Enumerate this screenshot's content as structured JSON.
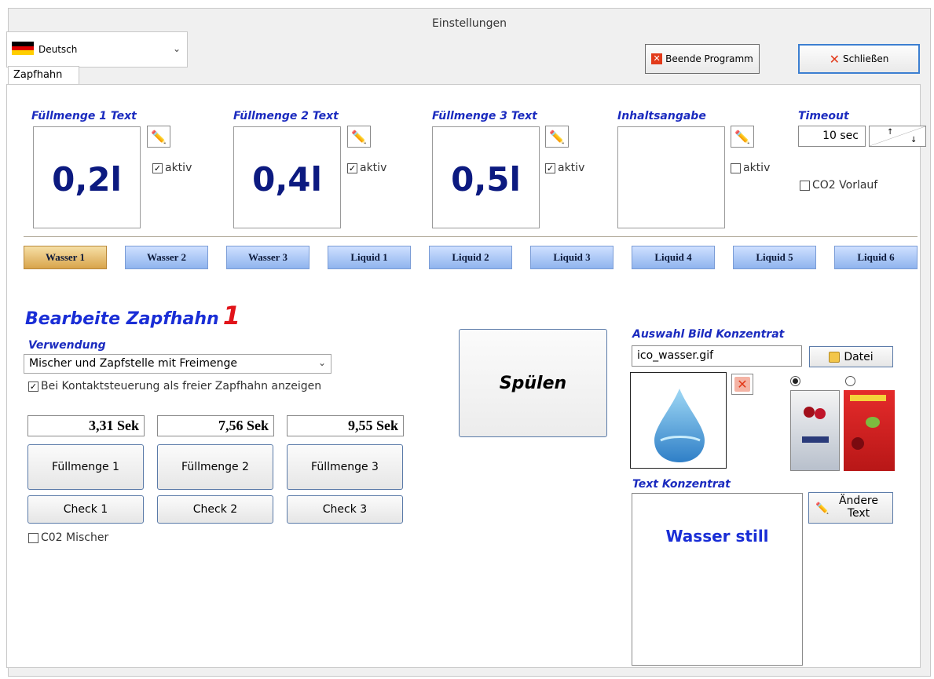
{
  "window": {
    "title": "Einstellungen"
  },
  "language": {
    "selected": "Deutsch"
  },
  "toolbar": {
    "end_program": "Beende Programm",
    "close": "Schließen"
  },
  "tabs": [
    {
      "label": "Zapfhahn"
    }
  ],
  "fill_texts": [
    {
      "header": "Füllmenge 1 Text",
      "value": "0,2l",
      "active_label": "aktiv",
      "active": true
    },
    {
      "header": "Füllmenge 2 Text",
      "value": "0,4l",
      "active_label": "aktiv",
      "active": true
    },
    {
      "header": "Füllmenge 3 Text",
      "value": "0,5l",
      "active_label": "aktiv",
      "active": true
    },
    {
      "header": "Inhaltsangabe",
      "value": "",
      "active_label": "aktiv",
      "active": false
    }
  ],
  "timeout": {
    "header": "Timeout",
    "value": "10 sec",
    "co2_label": "CO2 Vorlauf",
    "co2_checked": false
  },
  "taps": [
    {
      "label": "Wasser 1",
      "active": true
    },
    {
      "label": "Wasser 2",
      "active": false
    },
    {
      "label": "Wasser 3",
      "active": false
    },
    {
      "label": "Liquid 1",
      "active": false
    },
    {
      "label": "Liquid 2",
      "active": false
    },
    {
      "label": "Liquid 3",
      "active": false
    },
    {
      "label": "Liquid 4",
      "active": false
    },
    {
      "label": "Liquid 5",
      "active": false
    },
    {
      "label": "Liquid 6",
      "active": false
    }
  ],
  "editor": {
    "title": "Bearbeite Zapfhahn",
    "number": "1",
    "usage_header": "Verwendung",
    "usage_value": "Mischer und Zapfstelle mit Freimenge",
    "free_tap_label": "Bei Kontaktsteuerung als freier Zapfhahn anzeigen",
    "free_tap_checked": true,
    "times": [
      "3,31 Sek",
      "7,56 Sek",
      "9,55 Sek"
    ],
    "fill_buttons": [
      "Füllmenge 1",
      "Füllmenge 2",
      "Füllmenge 3"
    ],
    "check_buttons": [
      "Check 1",
      "Check 2",
      "Check 3"
    ],
    "co2_mixer_label": "C02 Mischer",
    "co2_mixer_checked": false,
    "flush_label": "Spülen"
  },
  "concentrate": {
    "image_header": "Auswahl Bild Konzentrat",
    "image_file": "ico_wasser.gif",
    "file_button": "Datei",
    "text_header": "Text Konzentrat",
    "text_value": "Wasser still",
    "change_text_button": "Ändere Text",
    "thumbnail_selected": 0
  },
  "colors": {
    "header_blue": "#1b2bbf",
    "value_navy": "#0c1a80",
    "accent_red": "#e1141a",
    "tab_active": "#d8a44b",
    "tab_inactive": "#8fb4ee"
  }
}
